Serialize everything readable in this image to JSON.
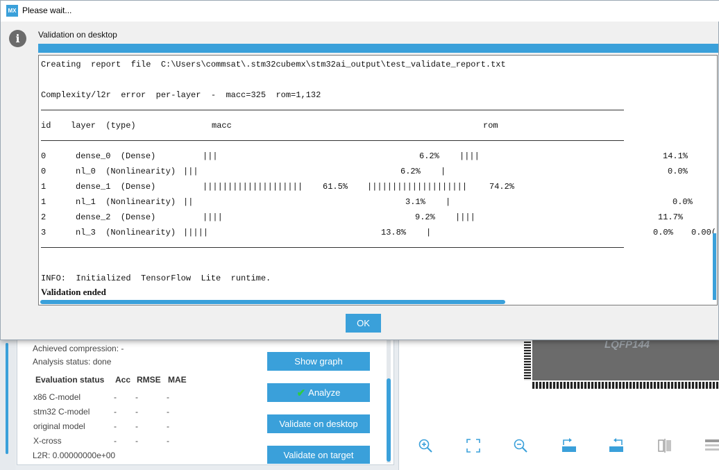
{
  "dialog": {
    "title": "Please wait...",
    "app_logo": "MX",
    "message": "Validation on desktop",
    "progress_percent": 100,
    "ok_label": "OK",
    "log": {
      "creating": "Creating  report  file  C:\\Users\\commsat\\.stm32cubemx\\stm32ai_output\\test_validate_report.txt",
      "complexity": "Complexity/l2r  error  per-layer  -  macc=325  rom=1,132",
      "header": {
        "id": "id",
        "layer": "layer  (type)",
        "macc": "macc",
        "rom": "rom"
      },
      "rows": [
        {
          "id": "0",
          "layer": "dense_0  (Dense)",
          "macc_bars": "|||",
          "macc_pct": "6.2%",
          "rom_bars": "||||",
          "rom_pct": "14.1%",
          "extra": ""
        },
        {
          "id": "0",
          "layer": "nl_0  (Nonlinearity)",
          "macc_bars": "|||",
          "macc_pct": "6.2%",
          "rom_bars": "|",
          "rom_pct": "0.0%",
          "extra": ""
        },
        {
          "id": "1",
          "layer": "dense_1  (Dense)",
          "macc_bars": "||||||||||||||||||||",
          "macc_pct": "61.5%",
          "rom_bars": "||||||||||||||||||||",
          "rom_pct": "74.2%",
          "extra": ""
        },
        {
          "id": "1",
          "layer": "nl_1  (Nonlinearity)",
          "macc_bars": "||",
          "macc_pct": "3.1%",
          "rom_bars": "|",
          "rom_pct": "0.0%",
          "extra": ""
        },
        {
          "id": "2",
          "layer": "dense_2  (Dense)",
          "macc_bars": "||||",
          "macc_pct": "9.2%",
          "rom_bars": "||||",
          "rom_pct": "11.7%",
          "extra": ""
        },
        {
          "id": "3",
          "layer": "nl_3  (Nonlinearity)",
          "macc_bars": "|||||",
          "macc_pct": "13.8%",
          "rom_bars": "|",
          "rom_pct": "0.0%",
          "extra": "0.00("
        }
      ],
      "info": "INFO:  Initialized  TensorFlow  Lite  runtime.",
      "ended": "Validation ended"
    }
  },
  "background": {
    "achieved_compression": "Achieved compression: -",
    "analysis_status": "Analysis status: done",
    "eval_headers": [
      "Evaluation status",
      "Acc",
      "RMSE",
      "MAE"
    ],
    "eval_rows": [
      {
        "name": "x86 C-model",
        "acc": "-",
        "rmse": "-",
        "mae": "-"
      },
      {
        "name": "stm32 C-model",
        "acc": "-",
        "rmse": "-",
        "mae": "-"
      },
      {
        "name": "original model",
        "acc": "-",
        "rmse": "-",
        "mae": "-"
      },
      {
        "name": "X-cross",
        "acc": "-",
        "rmse": "-",
        "mae": "-"
      }
    ],
    "l2r": "L2R: 0.00000000e+00",
    "buttons": {
      "show_graph": "Show graph",
      "analyze": "Analyze",
      "validate_desktop": "Validate on desktop",
      "validate_target": "Validate on target"
    },
    "chip_label": "LQFP144",
    "toolbar_icons": [
      "zoom-in-icon",
      "fit-screen-icon",
      "zoom-out-icon",
      "rotate-right-icon",
      "rotate-left-icon",
      "flip-icon",
      "list-icon"
    ]
  },
  "colors": {
    "accent": "#3aa0da",
    "chip": "#6b6b6b"
  }
}
